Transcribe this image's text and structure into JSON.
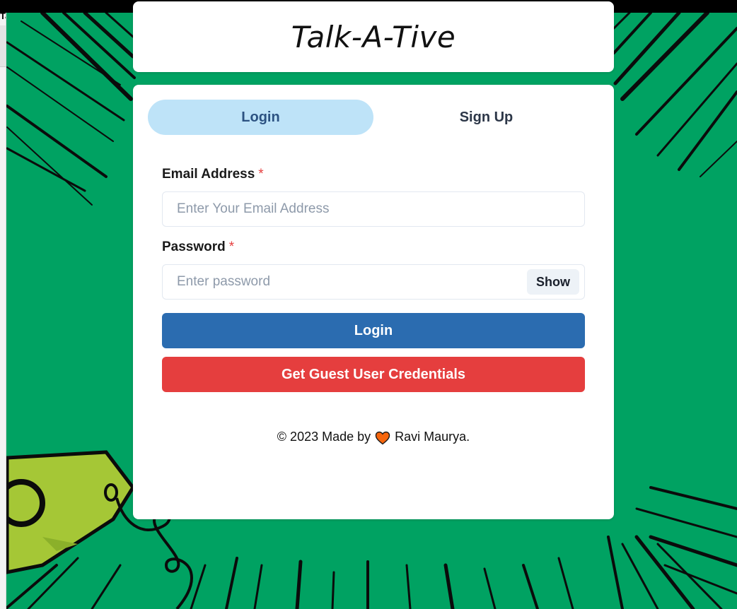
{
  "browser": {
    "tab_fragment": "Ta"
  },
  "header": {
    "title": "Talk-A-Tive"
  },
  "tabs": [
    {
      "label": "Login",
      "active": true
    },
    {
      "label": "Sign Up",
      "active": false
    }
  ],
  "form": {
    "email": {
      "label": "Email Address",
      "required_mark": "*",
      "value": "",
      "placeholder": "Enter Your Email Address"
    },
    "password": {
      "label": "Password",
      "required_mark": "*",
      "value": "",
      "placeholder": "Enter password",
      "toggle_label": "Show"
    },
    "login_button": "Login",
    "guest_button": "Get Guest User Credentials"
  },
  "footer": {
    "prefix": "© 2023 Made by",
    "icon": "heart-icon",
    "author": "Ravi Maurya."
  },
  "colors": {
    "background": "#00a262",
    "tab_active": "#bee3f8",
    "login_button": "#2b6cb0",
    "guest_button": "#e53e3e",
    "required_mark": "#e53e3e",
    "heart": "#f6660d"
  }
}
